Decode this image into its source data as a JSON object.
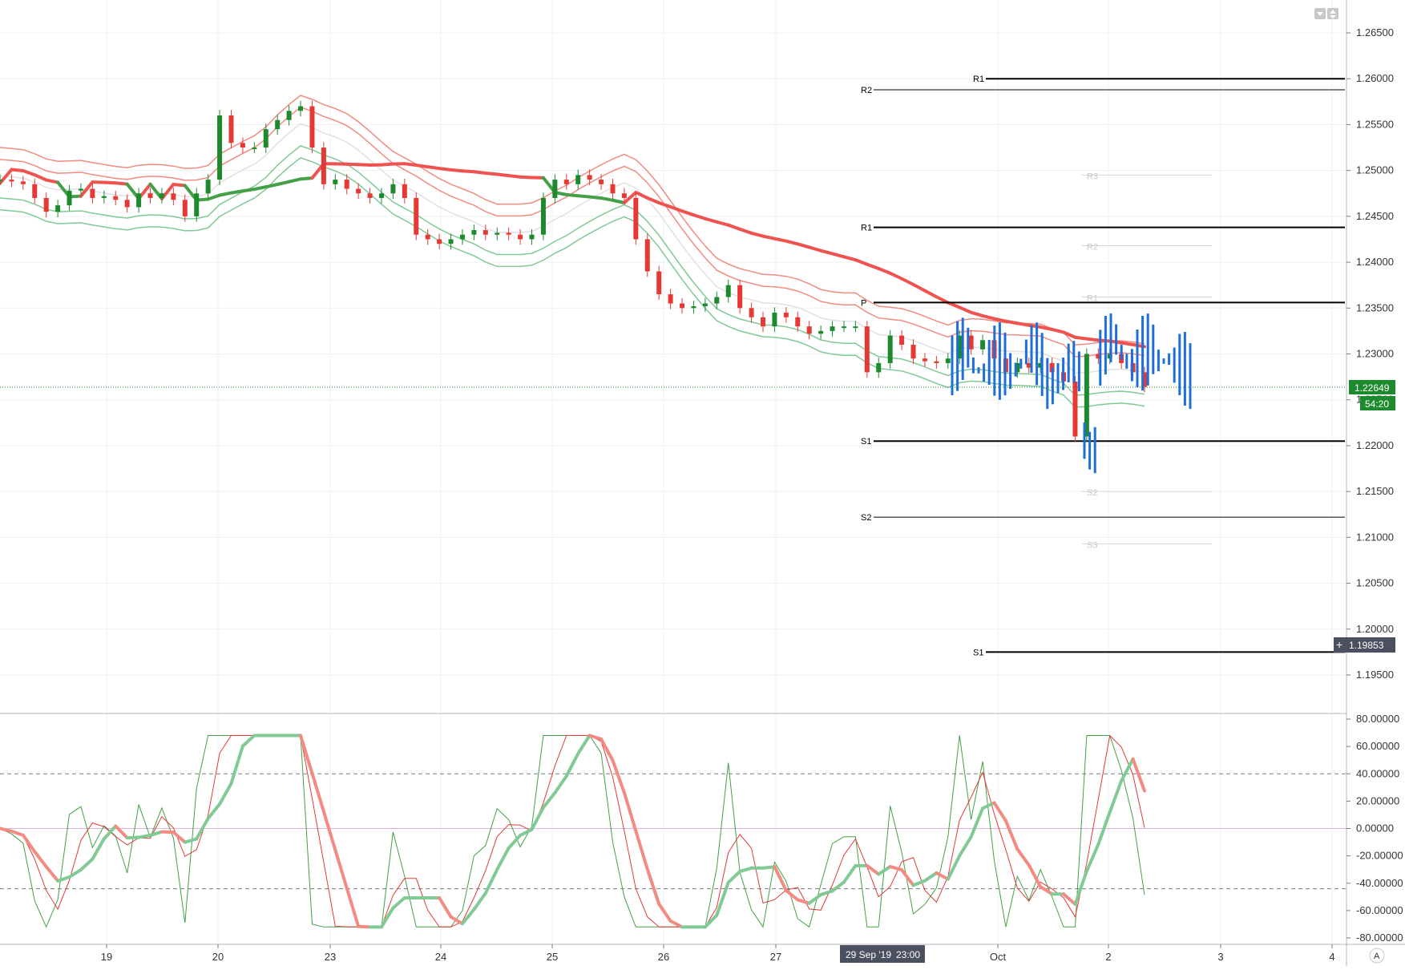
{
  "chart_data": {
    "type": "candlestick",
    "instrument_hint": "",
    "price_axis": {
      "ticks": [
        "1.26500",
        "1.26000",
        "1.25500",
        "1.25000",
        "1.24500",
        "1.24000",
        "1.23500",
        "1.23000",
        "1.22500",
        "1.22000",
        "1.21500",
        "1.21000",
        "1.20500",
        "1.20000",
        "1.19500"
      ],
      "range": [
        1.1935,
        1.2685
      ]
    },
    "time_axis": {
      "ticks": [
        "19",
        "20",
        "23",
        "24",
        "25",
        "26",
        "27",
        "Oct",
        "2",
        "3",
        "4"
      ]
    },
    "last_price": {
      "value": "1.22649",
      "countdown": "54:20"
    },
    "crosshair": {
      "price": "1.19853",
      "date": "29 Sep '19",
      "time": "23:00"
    },
    "pivot_levels": [
      {
        "label": "R1",
        "value": 1.26
      },
      {
        "label": "R2",
        "value": 1.2588
      },
      {
        "label": "R1",
        "value": 1.2438
      },
      {
        "label": "P",
        "value": 1.2356
      },
      {
        "label": "S1",
        "value": 1.2205
      },
      {
        "label": "S2",
        "value": 1.2122
      },
      {
        "label": "S1",
        "value": 1.1975
      }
    ],
    "faint_pivot_levels": [
      {
        "label": "R3",
        "value": 1.2495
      },
      {
        "label": "R2",
        "value": 1.2418
      },
      {
        "label": "R1",
        "value": 1.2362
      },
      {
        "label": "S2",
        "value": 1.215
      },
      {
        "label": "S3",
        "value": 1.2093
      }
    ],
    "ohlc_close_approx": [
      1.249,
      1.2488,
      1.2485,
      1.247,
      1.2455,
      1.2462,
      1.2478,
      1.248,
      1.247,
      1.2472,
      1.2468,
      1.246,
      1.2475,
      1.247,
      1.2475,
      1.2468,
      1.245,
      1.2475,
      1.249,
      1.256,
      1.253,
      1.2525,
      1.2525,
      1.2545,
      1.2555,
      1.2565,
      1.257,
      1.2525,
      1.2485,
      1.249,
      1.248,
      1.2475,
      1.247,
      1.2475,
      1.2485,
      1.247,
      1.243,
      1.2425,
      1.242,
      1.2425,
      1.243,
      1.2435,
      1.243,
      1.2432,
      1.243,
      1.2425,
      1.243,
      1.247,
      1.249,
      1.2485,
      1.2495,
      1.249,
      1.2485,
      1.2475,
      1.247,
      1.2425,
      1.239,
      1.2365,
      1.2355,
      1.235,
      1.2352,
      1.2355,
      1.2362,
      1.2375,
      1.235,
      1.234,
      1.233,
      1.2345,
      1.234,
      1.233,
      1.2322,
      1.2325,
      1.233,
      1.233,
      1.233,
      1.228,
      1.229,
      1.232,
      1.231,
      1.2295,
      1.2292,
      1.229,
      1.2295,
      1.232,
      1.2305,
      1.2315,
      1.2295,
      1.228,
      1.229,
      1.2285,
      1.229,
      1.228,
      1.227,
      1.221,
      1.23,
      1.2295,
      1.23,
      1.229,
      1.228,
      1.2264
    ],
    "oscillator": {
      "ticks": [
        "80.00000",
        "60.00000",
        "40.00000",
        "20.00000",
        "0.00000",
        "-20.00000",
        "-40.00000",
        "-60.00000",
        "-80.00000"
      ],
      "range": [
        -85,
        85
      ],
      "levels": [
        40,
        -44
      ]
    }
  },
  "ui": {
    "scale_button_label": "A"
  }
}
